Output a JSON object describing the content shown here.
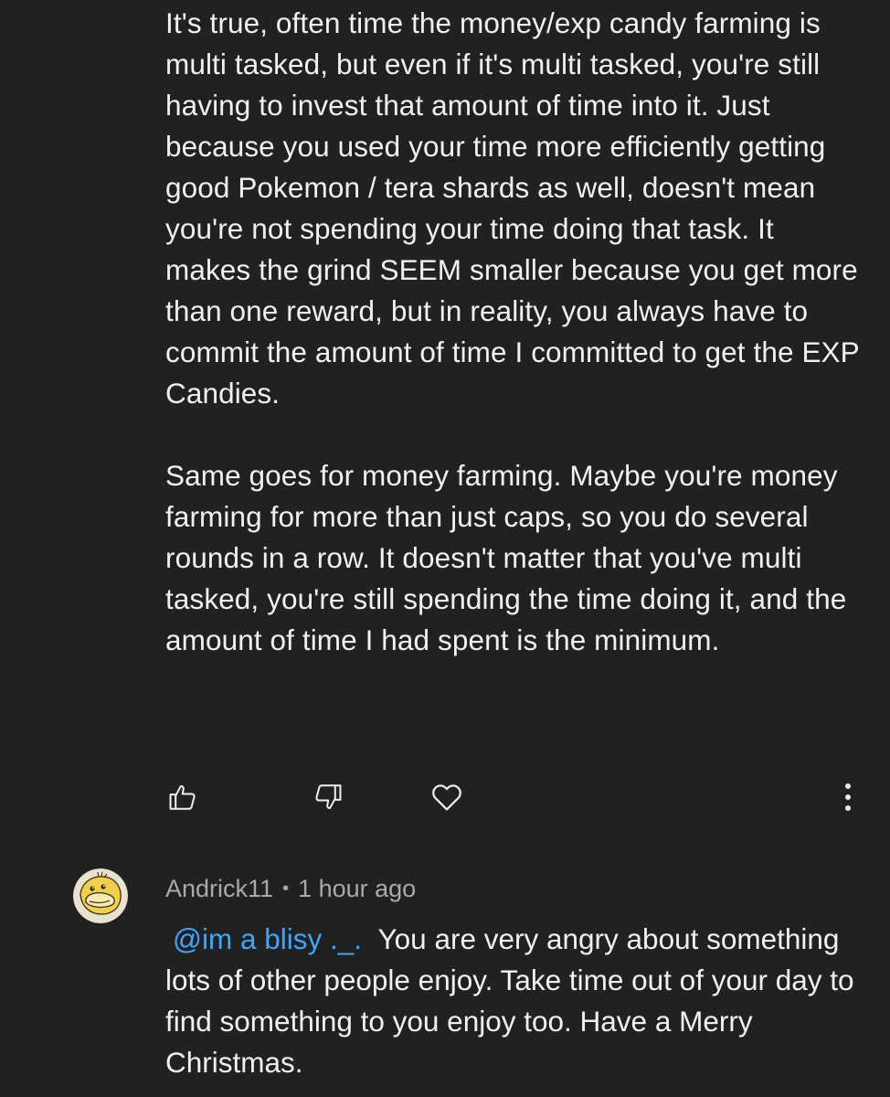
{
  "comment": {
    "paragraphs": [
      "It's true, often time the money/exp candy farming is multi tasked, but even if it's multi tasked, you're still having to invest that amount of time into it. Just because you used your time more efficiently getting good Pokemon / tera shards as well, doesn't mean you're not spending your time doing that task. It makes the grind SEEM smaller because you get more than one reward, but in reality, you always have to commit the amount of time I committed to get the EXP Candies.",
      "Same goes for money farming. Maybe you're money farming for more than just caps, so you do several rounds in a row. It doesn't matter that you've multi tasked, you're still spending the time doing it, and the amount of time I had spent is the minimum."
    ]
  },
  "actions": {
    "like_icon": "thumbs-up-icon",
    "dislike_icon": "thumbs-down-icon",
    "heart_icon": "heart-icon",
    "more_icon": "more-vertical-icon"
  },
  "reply": {
    "author": "Andrick11",
    "separator": "•",
    "time": "1 hour ago",
    "mention": "@im a blisy ._.",
    "text": "You are very angry about something lots of other people enjoy. Take time out of your day to find something to you enjoy too. Have a Merry Christmas.",
    "avatar_icon": "psyduck-avatar"
  },
  "colors": {
    "background": "#212121",
    "text": "#f1f1f1",
    "secondary_text": "#aaaaaa",
    "mention": "#3ea6ff"
  }
}
